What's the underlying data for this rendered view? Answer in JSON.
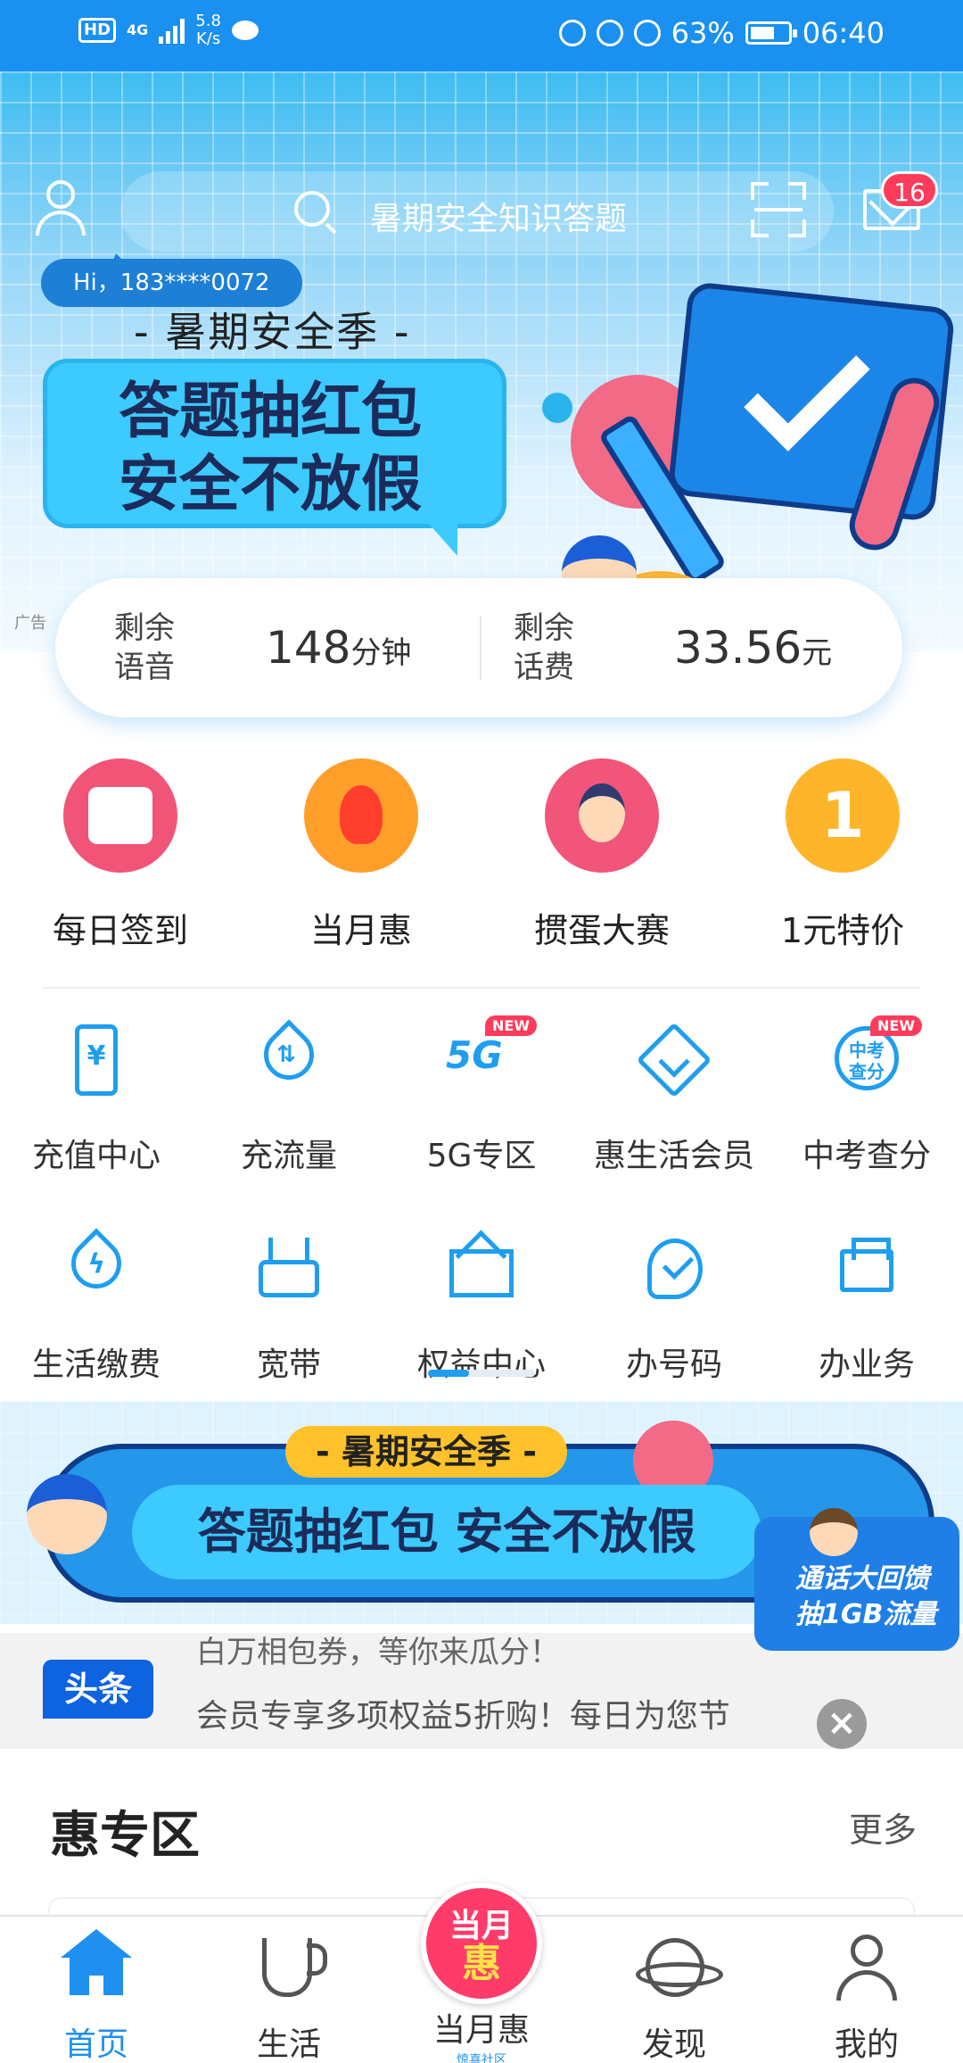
{
  "status_bar": {
    "hd": "HD",
    "signal": "4G",
    "net_speed": "5.8\nK/s",
    "battery": "63%",
    "time": "06:40"
  },
  "header": {
    "search_placeholder": "暑期安全知识答题",
    "message_count": "16",
    "greeting": "Hi，183****0072"
  },
  "hero_banner": {
    "subtitle": "- 暑期安全季 -",
    "line1": "答题抽红包",
    "line2": "安全不放假",
    "ad_tag": "广告"
  },
  "balance": {
    "voice_label": "剩余\n语音",
    "voice_value": "148",
    "voice_unit": "分钟",
    "fee_label": "剩余\n话费",
    "fee_value": "33.56",
    "fee_unit": "元"
  },
  "promos": [
    {
      "label": "每日签到",
      "icon": "calendar-check-icon"
    },
    {
      "label": "当月惠",
      "icon": "flame-icon"
    },
    {
      "label": "掼蛋大赛",
      "icon": "playing-cards-icon"
    },
    {
      "label": "1元特价",
      "icon": "one-yuan-icon",
      "icon_text": "1"
    }
  ],
  "services": [
    {
      "label": "充值中心",
      "icon": "phone-yuan-icon",
      "icon_text": "¥"
    },
    {
      "label": "充流量",
      "icon": "data-drop-icon",
      "icon_text": "⇅"
    },
    {
      "label": "5G专区",
      "icon": "5g-icon",
      "icon_text": "5G",
      "new": "NEW"
    },
    {
      "label": "惠生活会员",
      "icon": "diamond-icon"
    },
    {
      "label": "中考查分",
      "icon": "score-search-icon",
      "icon_text": "中考\n查分",
      "new": "NEW"
    },
    {
      "label": "生活缴费",
      "icon": "bolt-drop-icon",
      "icon_text": "ϟ"
    },
    {
      "label": "宽带",
      "icon": "router-icon"
    },
    {
      "label": "权益中心",
      "icon": "crown-icon"
    },
    {
      "label": "办号码",
      "icon": "sim-card-icon"
    },
    {
      "label": "办业务",
      "icon": "printer-icon"
    }
  ],
  "banner2": {
    "tag": "- 暑期安全季 -",
    "main": "答题抽红包  安全不放假"
  },
  "float_ad": {
    "line1": "通话大回馈",
    "line2": "抽1GB流量"
  },
  "news": {
    "tag": "头条",
    "line1": "白万相包券，等你来瓜分！",
    "line2": "会员专享多项权益5折购！每日为您节"
  },
  "section": {
    "title": "惠专区",
    "more": "更多"
  },
  "tabbar": {
    "tabs": [
      "首页",
      "生活",
      "发现",
      "我的"
    ],
    "middle_badge_top": "当月",
    "middle_badge_bottom": "惠",
    "middle_label": "当月惠",
    "middle_sub": "惊喜社区"
  },
  "colors": {
    "primary": "#1f8ff0",
    "status_bar": "#1a90f0",
    "badge_red": "#ff3b5c"
  }
}
